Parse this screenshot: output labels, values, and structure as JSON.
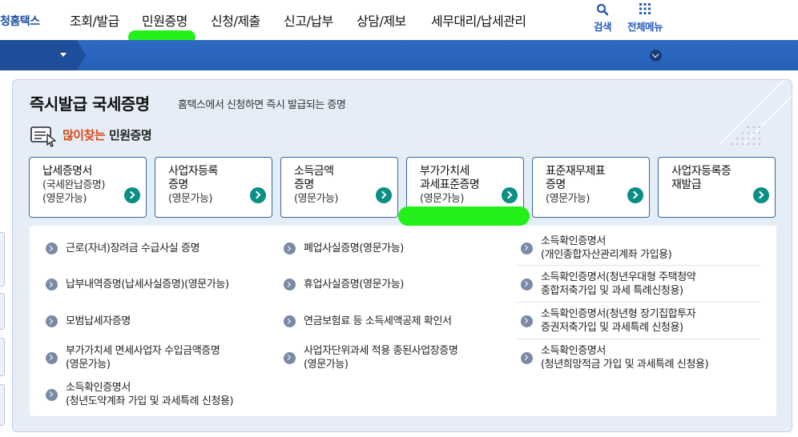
{
  "header": {
    "brand": "청홈택스",
    "menu": [
      "조회/발급",
      "민원증명",
      "신청/제출",
      "신고/납부",
      "상담/제보",
      "세무대리/납세관리"
    ],
    "tools": [
      {
        "icon": "search-icon",
        "label": "검색"
      },
      {
        "icon": "grid-menu-icon",
        "label": "전체메뉴"
      }
    ]
  },
  "colors": {
    "brand_blue": "#1a4ea0",
    "bar_blue": "#2a64bd",
    "panel_bg": "#e5edf7",
    "card_border": "#36679e",
    "go_teal": "#0b8f84",
    "accent_orange": "#d94a14",
    "highlight_green": "#22f018"
  },
  "section": {
    "title": "즉시발급 국세증명",
    "subtitle": "홈택스에서 신청하면 즉시 발급되는 증명",
    "popular_accent": "많이찾는",
    "popular_rest": "민원증명"
  },
  "cards": [
    {
      "line1": "납세증명서",
      "line2": "(국세완납증명)",
      "line3": "(영문가능)"
    },
    {
      "line1": "사업자등록",
      "line2": "증명",
      "line3": "(영문가능)"
    },
    {
      "line1": "소득금액",
      "line2": "증명",
      "line3": "(영문가능)"
    },
    {
      "line1": "부가가치세",
      "line2": "과세표준증명",
      "line3": "(영문가능)"
    },
    {
      "line1": "표준재무제표",
      "line2": "증명",
      "line3": "(영문가능)"
    },
    {
      "line1": "사업자등록증",
      "line2": "재발급",
      "line3": ""
    }
  ],
  "list": [
    {
      "line1": "근로(자녀)장려금 수급사실 증명",
      "line2": ""
    },
    {
      "line1": "폐업사실증명(영문가능)",
      "line2": ""
    },
    {
      "line1": "소득확인증명서",
      "line2": "(개인종합자산관리계좌 가입용)"
    },
    {
      "line1": "납부내역증명(납세사실증명)(영문가능)",
      "line2": ""
    },
    {
      "line1": "휴업사실증명(영문가능)",
      "line2": ""
    },
    {
      "line1": "소득확인증명서(청년우대형 주택청약",
      "line2": "종합저축가입 및 과세 특례신청용)"
    },
    {
      "line1": "모범납세자증명",
      "line2": ""
    },
    {
      "line1": "연금보험료 등 소득세액공제 확인서",
      "line2": ""
    },
    {
      "line1": "소득확인증명서(청년형 장기집합투자",
      "line2": "증권저축가입 및 과세특례 신청용)"
    },
    {
      "line1": "부가가치세 면세사업자 수입금액증명",
      "line2": "(영문가능)"
    },
    {
      "line1": "사업자단위과세 적용 종된사업장증명",
      "line2": "(영문가능)"
    },
    {
      "line1": "소득확인증명서",
      "line2": "(청년희망적금 가입 및 과세특례 신청용)"
    },
    {
      "line1": "소득확인증명서",
      "line2": "(청년도약계좌 가입 및 과세특례 신청용)"
    }
  ]
}
